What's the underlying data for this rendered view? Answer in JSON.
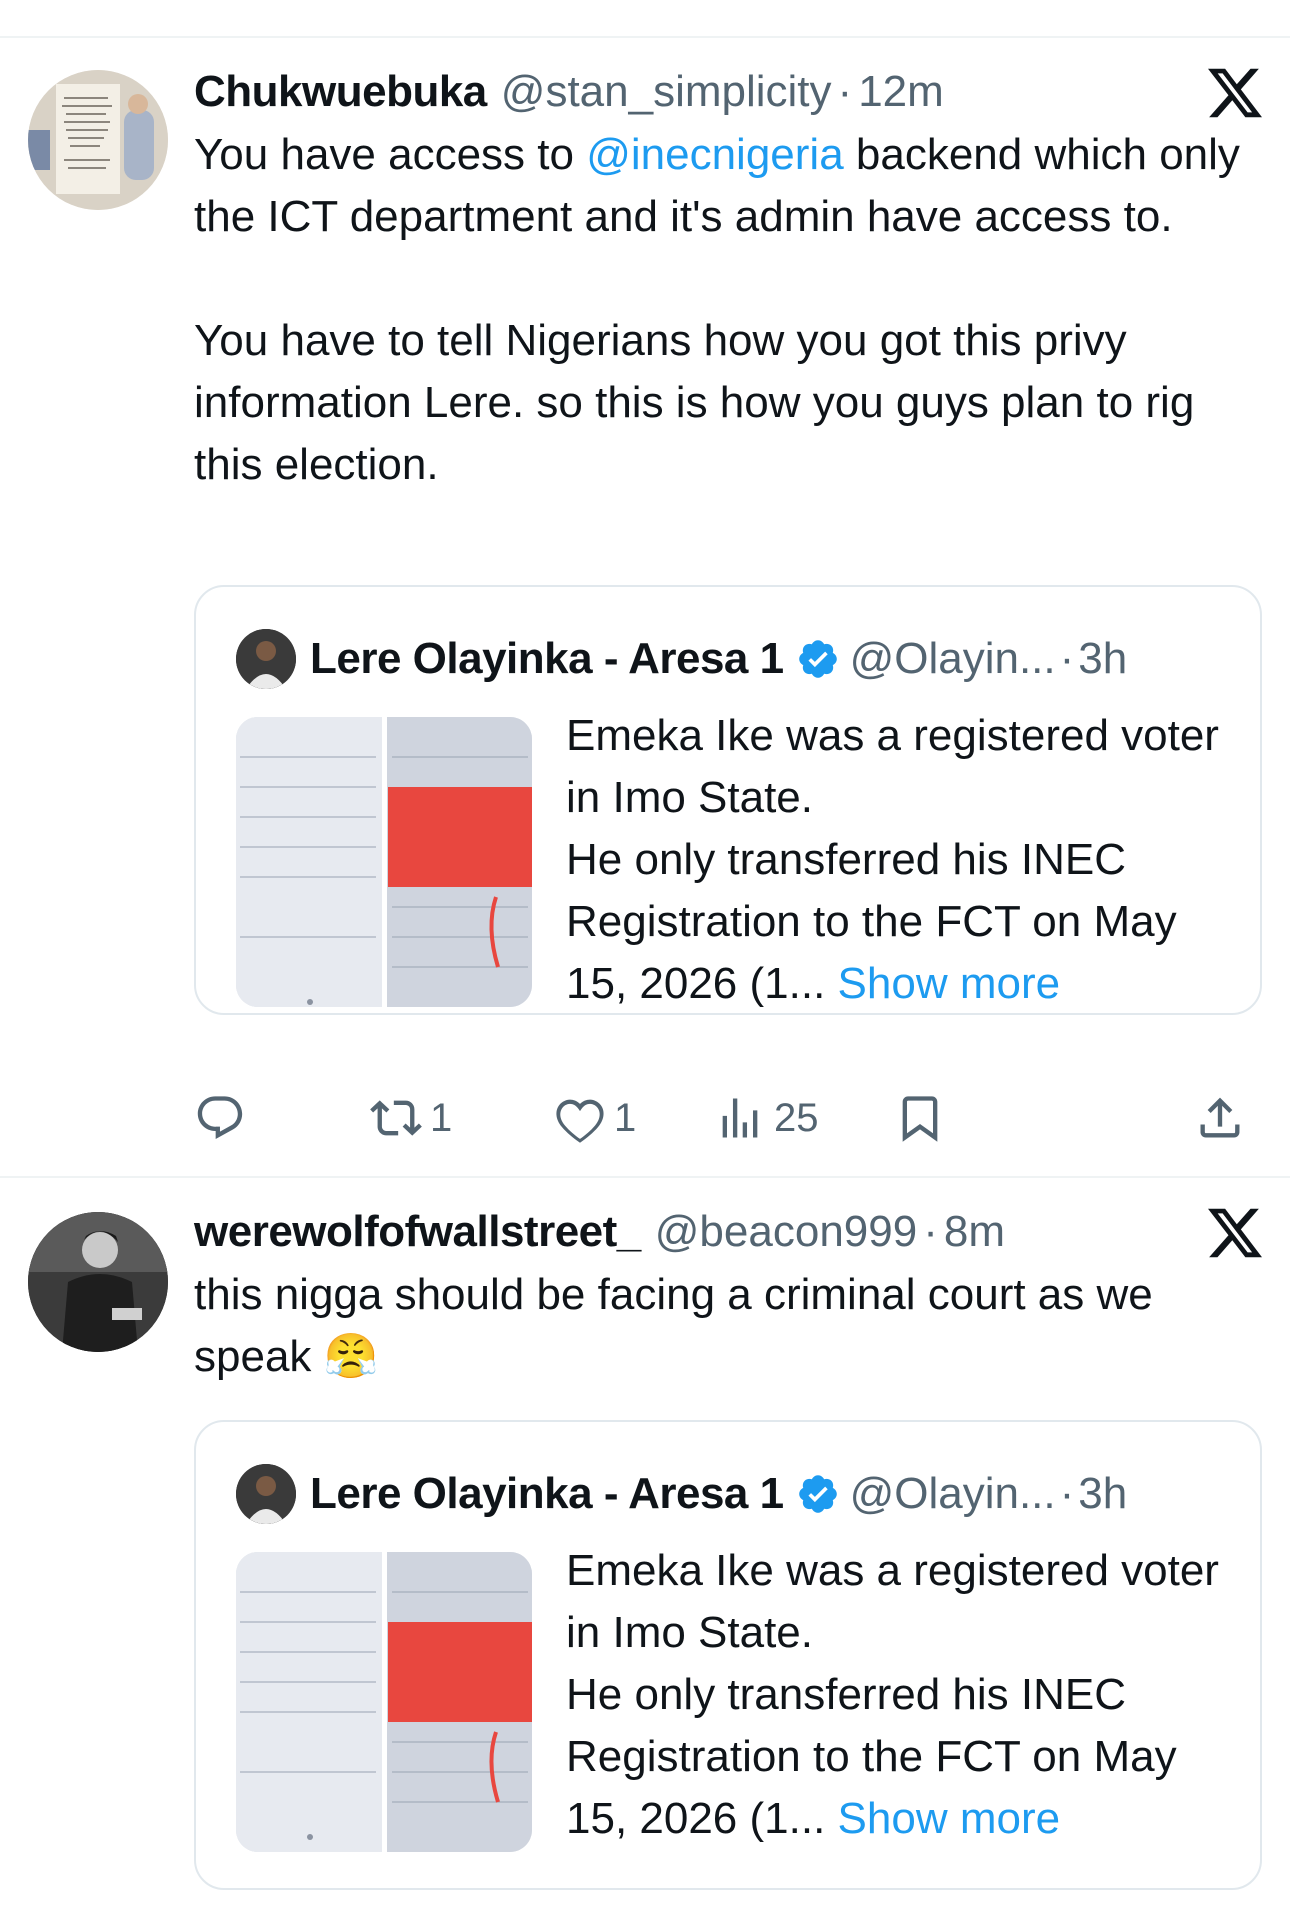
{
  "tweets": [
    {
      "author_name": "Chukwuebuka",
      "handle": "@stan_simplicity",
      "separator": "·",
      "time": "12m",
      "text_before_mention": "You have access to ",
      "mention": "@inecnigeria",
      "text_after_mention": " backend which only the ICT department and it's admin have access to.",
      "paragraph_2": "You have to tell Nigerians how you got this privy information Lere. so this is how you guys plan to rig this election.",
      "quote": {
        "author_name": "Lere Olayinka - Aresa 1",
        "handle": "@Olayin...",
        "separator": "·",
        "time": "3h",
        "text": "Emeka Ike was a registered voter in Imo State.\nHe only transferred his INEC Registration to the FCT on May 15, 2026 (1...",
        "show_more": "Show more"
      },
      "actions": {
        "reply_count": "",
        "repost_count": "1",
        "like_count": "1",
        "views_count": "25"
      }
    },
    {
      "author_name": "werewolfofwallstreet_",
      "handle": "@beacon999",
      "separator": "·",
      "time": "8m",
      "text": "this nigga should be facing a criminal court as we speak",
      "emoji": "😤",
      "quote": {
        "author_name": "Lere Olayinka - Aresa 1",
        "handle": "@Olayin...",
        "separator": "·",
        "time": "3h",
        "text": "Emeka Ike was a registered voter in Imo State.\nHe only transferred his INEC Registration to the FCT on May 15, 2026 (1...",
        "show_more": "Show more"
      }
    }
  ],
  "colors": {
    "link": "#1d9bf0",
    "secondary_text": "#536471",
    "primary_text": "#0f1419",
    "divider": "#eff3f4",
    "redaction": "#e8473f"
  },
  "icons": [
    "x-logo-icon",
    "verified-badge-icon",
    "reply-icon",
    "repost-icon",
    "like-icon",
    "views-icon",
    "bookmark-icon",
    "share-icon"
  ]
}
